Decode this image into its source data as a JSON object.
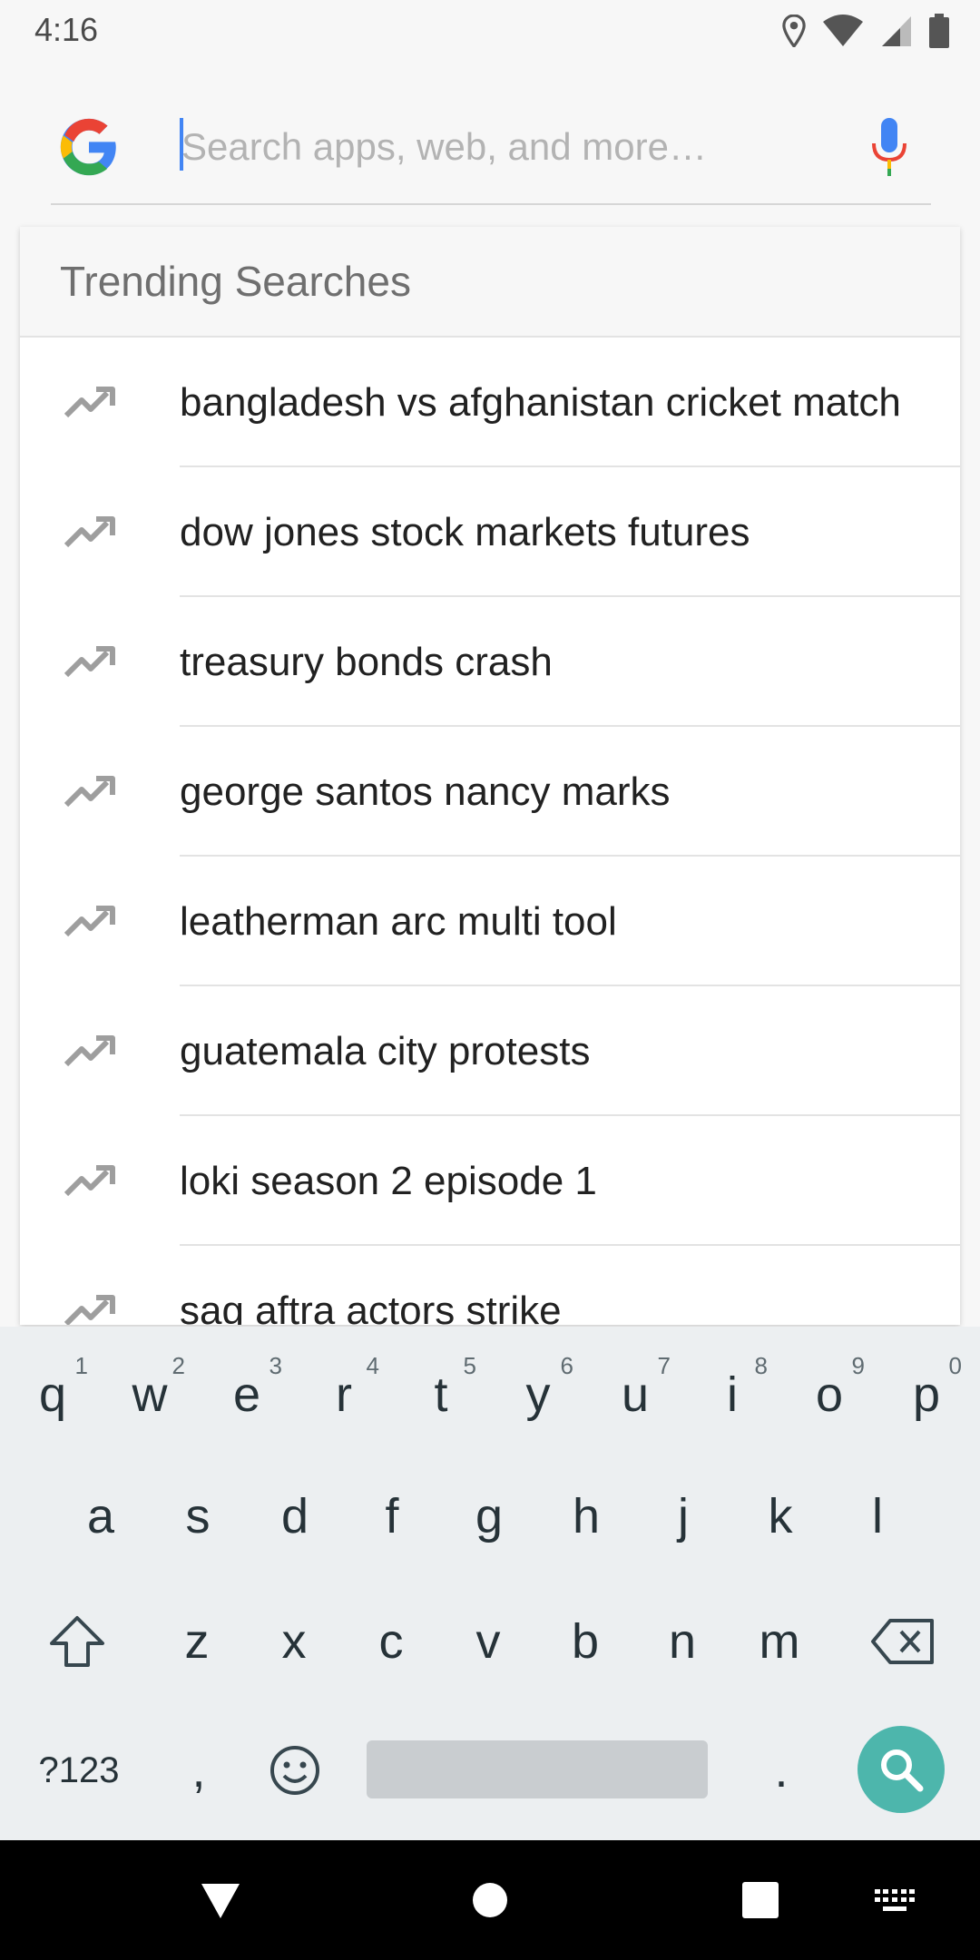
{
  "status_bar": {
    "time": "4:16",
    "icons": [
      "location-icon",
      "wifi-icon",
      "cell-signal-icon",
      "battery-icon"
    ]
  },
  "search": {
    "placeholder": "Search apps, web, and more…",
    "value": "",
    "logo": "google-g-icon",
    "mic": "mic-icon"
  },
  "trending": {
    "title": "Trending Searches",
    "icon": "trending-up-icon",
    "items": [
      "bangladesh vs afghanistan cricket match",
      "dow jones stock markets futures",
      "treasury bonds crash",
      "george santos nancy marks",
      "leatherman arc multi tool",
      "guatemala city protests",
      "loki season 2 episode 1",
      "sag aftra actors strike"
    ]
  },
  "keyboard": {
    "row1": [
      {
        "key": "q",
        "hint": "1"
      },
      {
        "key": "w",
        "hint": "2"
      },
      {
        "key": "e",
        "hint": "3"
      },
      {
        "key": "r",
        "hint": "4"
      },
      {
        "key": "t",
        "hint": "5"
      },
      {
        "key": "y",
        "hint": "6"
      },
      {
        "key": "u",
        "hint": "7"
      },
      {
        "key": "i",
        "hint": "8"
      },
      {
        "key": "o",
        "hint": "9"
      },
      {
        "key": "p",
        "hint": "0"
      }
    ],
    "row2": [
      "a",
      "s",
      "d",
      "f",
      "g",
      "h",
      "j",
      "k",
      "l"
    ],
    "row3": [
      "z",
      "x",
      "c",
      "v",
      "b",
      "n",
      "m"
    ],
    "symbols_label": "?123",
    "comma": ",",
    "period": ".",
    "shift": "shift-icon",
    "backspace": "backspace-icon",
    "emoji": "emoji-icon",
    "search_action": "search-icon",
    "accent_color": "#4db6ac"
  },
  "nav_bar": {
    "buttons": [
      "back-icon",
      "home-icon",
      "recents-icon",
      "keyboard-switch-icon"
    ]
  }
}
